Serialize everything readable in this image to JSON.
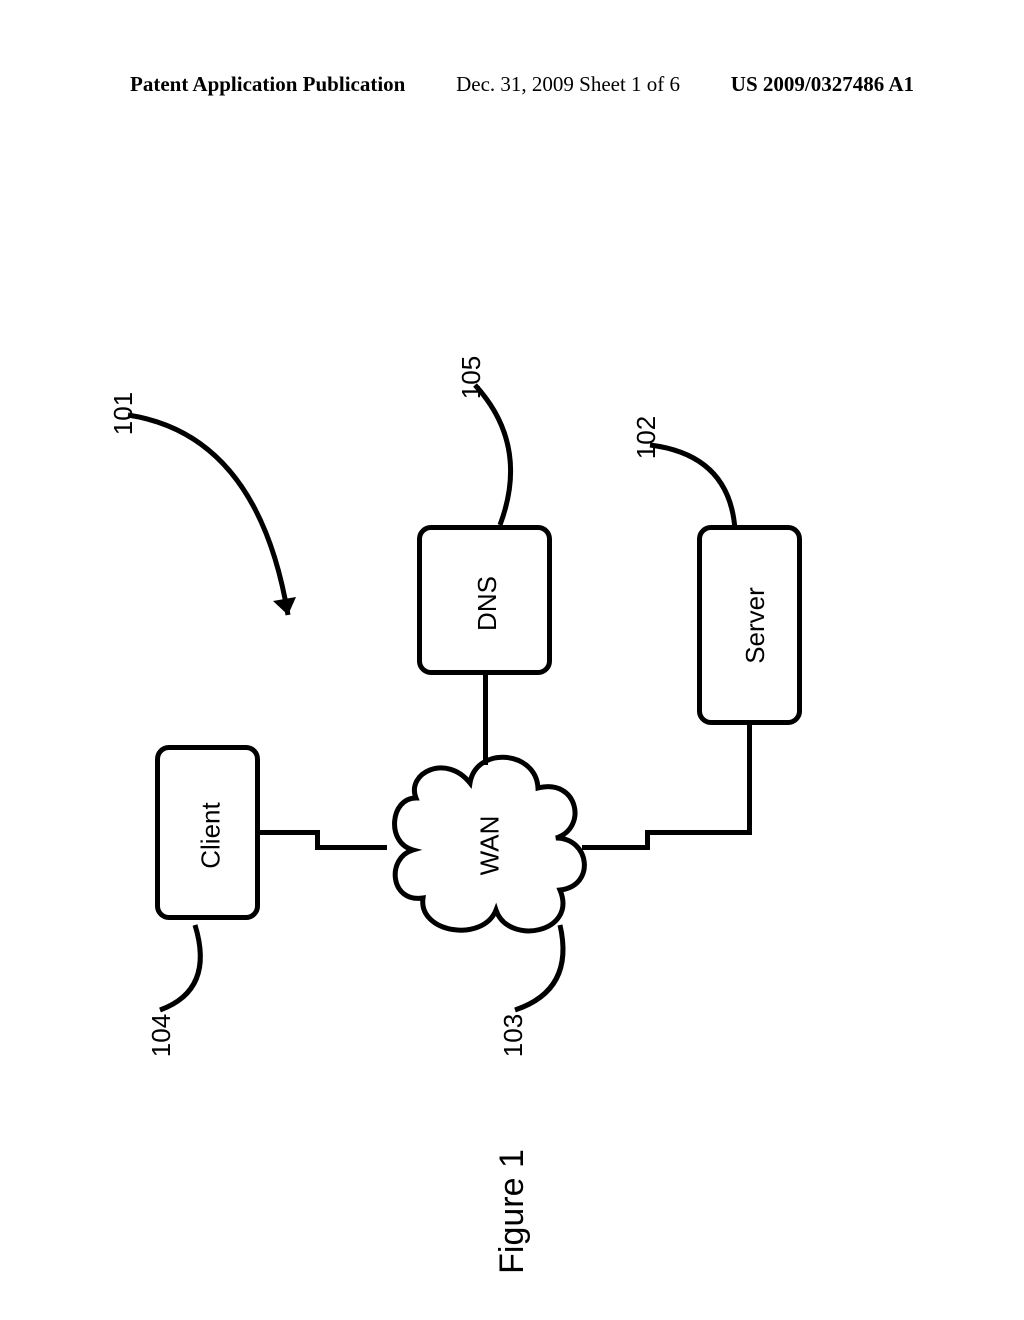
{
  "header": {
    "left": "Patent Application Publication",
    "center": "Dec. 31, 2009  Sheet 1 of 6",
    "right": "US 2009/0327486 A1"
  },
  "figure": {
    "caption": "Figure 1",
    "refs": {
      "system": "101",
      "server": "102",
      "wan": "103",
      "client": "104",
      "dns": "105"
    },
    "labels": {
      "server": "Server",
      "wan": "WAN",
      "client": "Client",
      "dns": "DNS"
    }
  }
}
